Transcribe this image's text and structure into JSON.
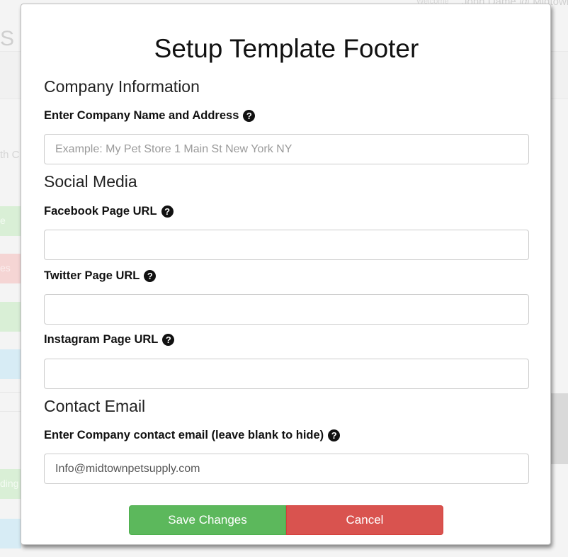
{
  "background": {
    "heading_fragment": "S",
    "user_tag": "Welcome",
    "user_name": "John Dame @ Midtown",
    "side_text": "th C",
    "side_buttons": [
      "e",
      "es",
      "",
      "",
      "ding",
      ""
    ]
  },
  "modal": {
    "title": "Setup Template Footer",
    "sections": {
      "company": "Company Information",
      "social": "Social Media",
      "contact": "Contact Email"
    },
    "fields": {
      "company_name": {
        "label": "Enter Company Name and Address",
        "value": "",
        "placeholder": "Example: My Pet Store 1 Main St New York NY"
      },
      "facebook": {
        "label": "Facebook Page URL",
        "value": "",
        "placeholder": ""
      },
      "twitter": {
        "label": "Twitter Page URL",
        "value": "",
        "placeholder": ""
      },
      "instagram": {
        "label": "Instagram Page URL",
        "value": "",
        "placeholder": ""
      },
      "contact_email": {
        "label": "Enter Company contact email (leave blank to hide)",
        "value": "Info@midtownpetsupply.com",
        "placeholder": ""
      }
    },
    "help_icon_glyph": "?",
    "buttons": {
      "save": "Save Changes",
      "cancel": "Cancel"
    }
  },
  "colors": {
    "save": "#5cb85c",
    "cancel": "#d9534f"
  }
}
